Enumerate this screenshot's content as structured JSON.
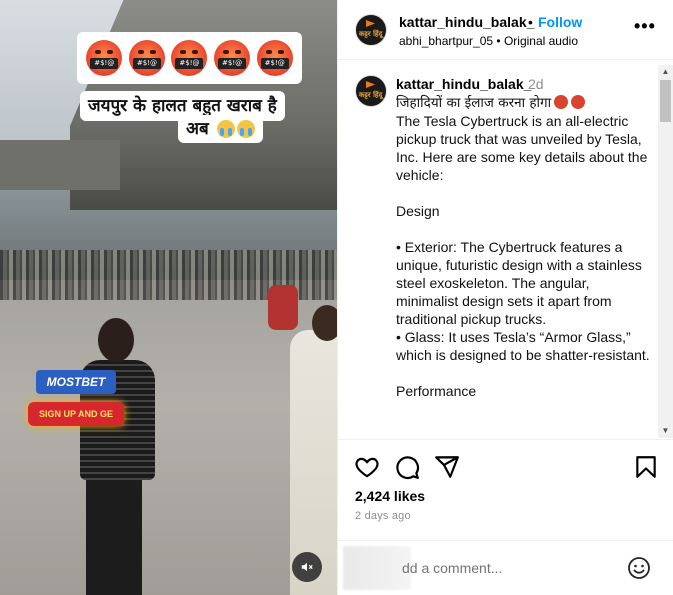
{
  "media": {
    "emoji_censor": "#$!@",
    "caption_line1": "जयपुर के हालत बहुत खराब है",
    "caption_line2": "अब",
    "ad_brand": "MOSTBET",
    "ad_button": "SIGN UP AND GE",
    "mute_icon": "speaker-muted-icon"
  },
  "header": {
    "username": "kattar_hindu_balak_",
    "separator": "•",
    "follow_label": "Follow",
    "subtitle": "abhi_bhartpur_05 • Original audio",
    "more_label": "•••",
    "avatar_text": "कट्टर हिंदू"
  },
  "comment": {
    "username": "kattar_hindu_balak_",
    "time": "2d",
    "hindi_line": "जिहादियों का ईलाज करना होगा",
    "body": "The Tesla Cybertruck is an all-electric pickup truck that was unveiled by Tesla, Inc. Here are some key details about the vehicle:\n\nDesign\n\n• Exterior: The Cybertruck features a unique, futuristic design with a stainless steel exoskeleton. The angular, minimalist design sets it apart from traditional pickup trucks.\n• Glass: It uses Tesla’s “Armor Glass,” which is designed to be shatter-resistant.\n\nPerformance"
  },
  "actions": {
    "likes": "2,424 likes",
    "date": "2 days ago"
  },
  "comment_input": {
    "placeholder": "dd a comment..."
  },
  "colors": {
    "follow": "#0095f6",
    "muted_text": "#8e8e8e"
  }
}
